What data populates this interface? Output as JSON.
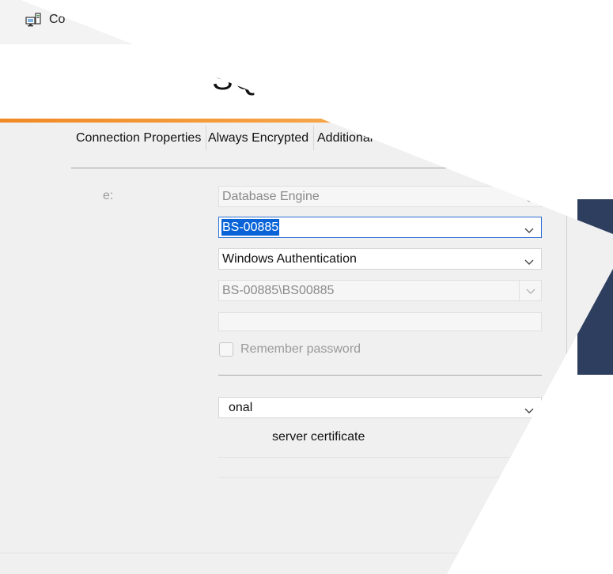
{
  "window": {
    "title_fragment": "Co"
  },
  "banner": {
    "text_fragment": "SQ"
  },
  "tabs": [
    {
      "label": "Connection Properties",
      "active": true
    },
    {
      "label": "Always Encrypted",
      "active": false
    },
    {
      "label": "Additional Conne",
      "active": false
    }
  ],
  "form": {
    "server_type_label_fragment": "e:",
    "server_type_value": "Database Engine",
    "server_name_value": "BS-00885",
    "authentication_value": "Windows Authentication",
    "user_name_value": "BS-00885\\BS00885",
    "password_value": "",
    "remember_password_label": "Remember password",
    "remember_password_checked": false,
    "encryption_value_fragment": "onal",
    "trust_cert_label_fragment": "server certificate"
  },
  "colors": {
    "accent_orange": "#f08a24",
    "selection_blue": "#0a64d8",
    "focus_border": "#2a6fd6",
    "background_navy": "#2d3e5e"
  },
  "icons": {
    "window_icon": "server-connect-icon",
    "dropdown": "chevron-down-icon"
  }
}
